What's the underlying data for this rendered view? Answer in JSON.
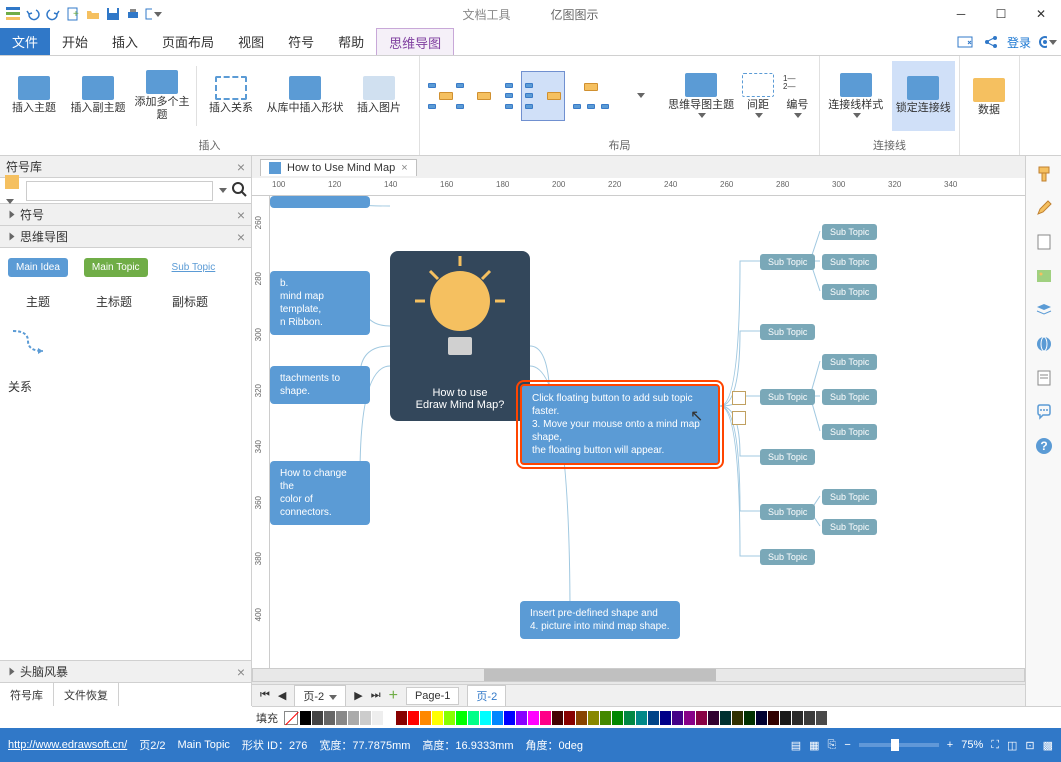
{
  "titlebar": {
    "doctools_label": "文档工具",
    "app_name": "亿图图示"
  },
  "menu": {
    "file": "文件",
    "items": [
      "开始",
      "插入",
      "页面布局",
      "视图",
      "符号",
      "帮助",
      "思维导图"
    ],
    "login": "登录"
  },
  "ribbon": {
    "groups": {
      "insert": {
        "label": "插入",
        "btns": [
          "插入主题",
          "插入副主题",
          "添加多个主题",
          "插入关系",
          "从库中插入形状",
          "插入图片"
        ]
      },
      "layout": {
        "label": "布局",
        "btns": [
          "思维导图主题",
          "间距",
          "编号"
        ]
      },
      "connect": {
        "label": "连接线",
        "btns": [
          "连接线样式",
          "锁定连接线"
        ]
      },
      "data": {
        "label": "数据"
      }
    }
  },
  "left": {
    "title": "符号库",
    "sections": {
      "symbols": "符号",
      "mindmap": "思维导图",
      "brainstorm": "头脑风暴"
    },
    "shapes": {
      "main_idea": "Main Idea",
      "main_topic": "Main Topic",
      "sub_topic": "Sub Topic",
      "theme": "主题",
      "main_title": "主标题",
      "subtitle": "副标题",
      "relation": "关系"
    },
    "tabs": [
      "符号库",
      "文件恢复"
    ]
  },
  "doc": {
    "tab_title": "How to Use Mind Map"
  },
  "ruler_h": [
    "100",
    "120",
    "140",
    "160",
    "180",
    "200",
    "220",
    "240",
    "260",
    "280",
    "300",
    "320",
    "340"
  ],
  "ruler_v": [
    "260",
    "280",
    "300",
    "320",
    "340",
    "360",
    "380",
    "400"
  ],
  "mindmap": {
    "central": "How to use\nEdraw Mind Map?",
    "node_template": "b.\nmind map template,\nn Ribbon.",
    "node_attach": "ttachments to shape.",
    "node_connectors": "How to change the\ncolor of connectors.",
    "node_selected": "Click floating button to add sub topic faster.\n3.  Move your mouse onto a mind map shape,\nthe floating button will appear.",
    "node_insert": "Insert pre-defined shape and\n4.  picture into mind map shape.",
    "sub_topic": "Sub Topic"
  },
  "pagebar": {
    "page_dropdown": "页-2",
    "page1": "Page-1",
    "page2": "页-2"
  },
  "palette": {
    "label": "填充"
  },
  "status": {
    "url": "http://www.edrawsoft.cn/",
    "page": "页2/2",
    "shape": "Main Topic",
    "id_label": "形状 ID：276",
    "width": "宽度：77.7875mm",
    "height": "高度：16.9333mm",
    "angle": "角度：0deg",
    "zoom": "75%"
  }
}
